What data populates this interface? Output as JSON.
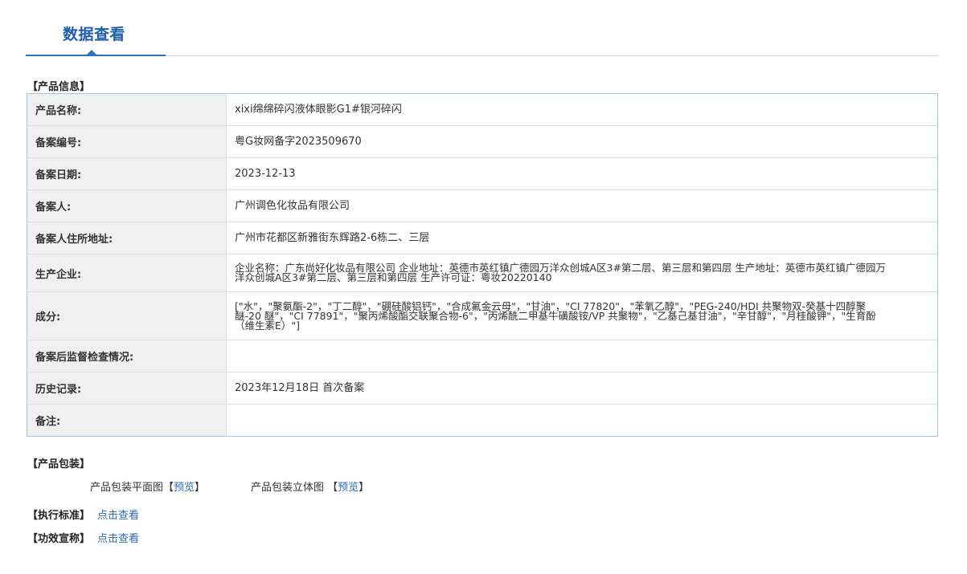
{
  "tab": {
    "title": "数据查看"
  },
  "sections": {
    "product_info": "【产品信息】",
    "packaging": "【产品包装】",
    "standard": "【执行标准】",
    "efficacy": "【功效宣称】"
  },
  "info_rows": [
    {
      "label": "产品名称:",
      "value": "xixi绵绵碎闪液体眼影G1#银河碎闪"
    },
    {
      "label": "备案编号:",
      "value": "粤G妆网备字2023509670"
    },
    {
      "label": "备案日期:",
      "value": "2023-12-13"
    },
    {
      "label": "备案人:",
      "value": "广州调色化妆品有限公司"
    },
    {
      "label": "备案人住所地址:",
      "value": "广州市花都区新雅街东辉路2-6栋二、三层"
    },
    {
      "label": "生产企业:",
      "value": "企业名称：广东尚好化妆品有限公司 企业地址：英德市英红镇广德园万洋众创城A区3#第二层、第三层和第四层 生产地址：英德市英红镇广德园万洋众创城A区3#第二层、第三层和第四层 生产许可证：粤妆20220140"
    },
    {
      "label": "成分:",
      "value": "[\"水\"，\"聚氨酯-2\"，\"丁二醇\"，\"硼硅酸铝钙\"，\"合成氟金云母\"，\"甘油\"，\"CI 77820\"，\"苯氧乙醇\"，\"PEG-240/HDI 共聚物双-癸基十四醇聚醚-20 醚\"，\"CI 77891\"，\"聚丙烯酸酯交联聚合物-6\"，\"丙烯酰二甲基牛磺酸铵/VP 共聚物\"，\"乙基己基甘油\"，\"辛甘醇\"，\"月桂酸钾\"，\"生育酚（维生素E）\"]"
    },
    {
      "label": "备案后监督检查情况:",
      "value": ""
    },
    {
      "label": "历史记录:",
      "value": "2023年12月18日 首次备案"
    },
    {
      "label": "备注:",
      "value": ""
    }
  ],
  "packaging": {
    "flat_label": "产品包装平面图【",
    "flat_link": "预览",
    "flat_close": "】",
    "solid_label": "产品包装立体图 【",
    "solid_link": "预览",
    "solid_close": "】"
  },
  "links": {
    "standard": "点击查看",
    "efficacy": "点击查看"
  }
}
